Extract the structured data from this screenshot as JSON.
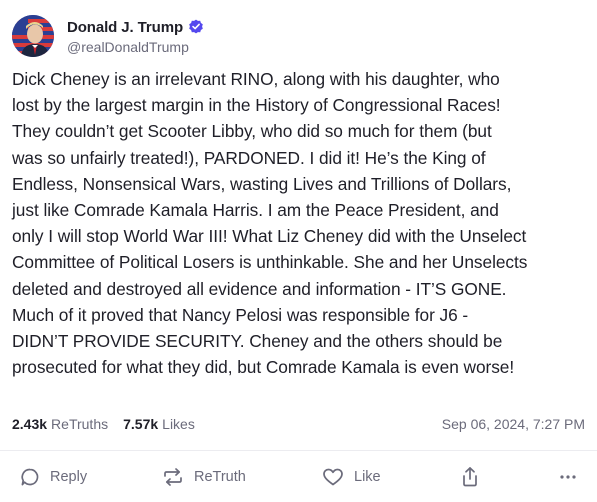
{
  "author": {
    "display_name": "Donald J. Trump",
    "handle": "@realDonaldTrump"
  },
  "post": {
    "text": "Dick Cheney is an irrelevant RINO, along with his daughter, who lost by the largest margin in the History of Congressional Races! They couldn’t get Scooter Libby, who did so much for them (but was so unfairly treated!), PARDONED. I did it! He’s the King of Endless, Nonsensical Wars, wasting Lives and Trillions of Dollars, just like Comrade Kamala Harris. I am the Peace President, and only I will stop World War III! What Liz Cheney did with the Unselect Committee of Political Losers is unthinkable. She and her Unselects deleted and destroyed all evidence and information - IT’S GONE. Much of it proved that Nancy Pelosi was responsible for J6 - DIDN’T PROVIDE SECURITY. Cheney and the others should be prosecuted for what they did, but Comrade Kamala is even worse!",
    "lines": [
      "Dick Cheney is an irrelevant RINO, along with his daughter, who",
      "lost by the largest margin in the History of Congressional Races!",
      "They couldn’t get Scooter Libby, who did so much for them (but",
      "was so unfairly treated!), PARDONED. I did it! He’s the King of",
      "Endless, Nonsensical Wars, wasting Lives and Trillions of Dollars,",
      "just like Comrade Kamala Harris. I am the Peace President, and",
      "only I will stop World War III! What Liz Cheney did with the Unselect",
      "Committee of Political Losers is unthinkable. She and her Unselects",
      "deleted and destroyed all evidence and information - IT’S GONE.",
      "Much of it proved that Nancy Pelosi was responsible for J6 -",
      "DIDN’T PROVIDE SECURITY. Cheney and the others should be",
      "prosecuted for what they did, but Comrade Kamala is even worse!"
    ]
  },
  "stats": {
    "retruths_count": "2.43k",
    "retruths_label": "ReTruths",
    "likes_count": "7.57k",
    "likes_label": "Likes",
    "timestamp": "Sep 06, 2024, 7:27 PM"
  },
  "actions": {
    "reply": "Reply",
    "retruth": "ReTruth",
    "like": "Like"
  },
  "icons": {
    "verified": "verified-badge-icon",
    "reply": "speech-bubble-icon",
    "retruth": "retruth-arrows-icon",
    "like": "heart-icon",
    "share": "share-upload-icon",
    "more": "more-dots-icon"
  },
  "colors": {
    "verified": "#5448ee",
    "text": "#1f1f28",
    "muted": "#6b6b7b",
    "divider": "#ececf0"
  }
}
